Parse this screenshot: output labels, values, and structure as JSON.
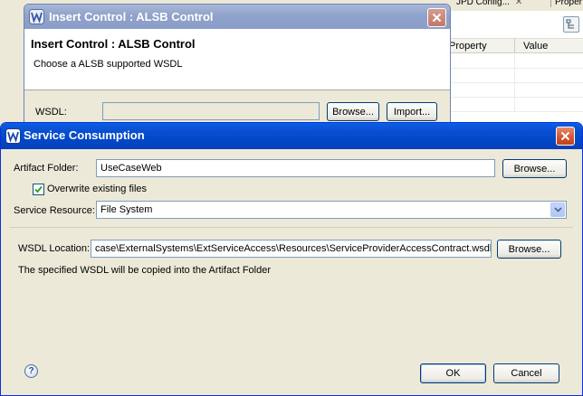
{
  "background": {
    "tabs": [
      {
        "label": "JPD Config...",
        "close": "✕"
      },
      {
        "label": "Proper"
      }
    ],
    "properties_header": {
      "property": "Property",
      "value": "Value"
    }
  },
  "insert_dialog": {
    "title": "Insert Control : ALSB Control",
    "heading": "Insert Control : ALSB Control",
    "subtitle": "Choose a ALSB supported WSDL",
    "wsdl_label": "WSDL:",
    "wsdl_value": "",
    "browse_label": "Browse...",
    "import_label": "Import..."
  },
  "service_dialog": {
    "title": "Service Consumption",
    "artifact_folder": {
      "label": "Artifact Folder:",
      "value": "UseCaseWeb",
      "browse_label": "Browse..."
    },
    "overwrite": {
      "label": "Overwrite existing files",
      "checked": true
    },
    "service_resource": {
      "label": "Service Resource:",
      "selected": "File System"
    },
    "wsdl_location": {
      "label": "WSDL Location:",
      "value": "case\\ExternalSystems\\ExtServiceAccess\\Resources\\ServiceProviderAccessContract.wsdl",
      "browse_label": "Browse...",
      "note": "The specified WSDL will be copied into the Artifact Folder"
    },
    "ok_label": "OK",
    "cancel_label": "Cancel"
  },
  "icons": {
    "app_logo": "weblogic-logo-icon",
    "close": "close-icon",
    "help": "help-icon",
    "dropdown": "chevron-down-icon",
    "check": "checkmark-icon",
    "toolbar": "view-toolbar-icon"
  },
  "colors": {
    "title_active": "#0a4fd0",
    "title_inactive": "#8fa2ca",
    "close_active": "#d2532d",
    "dialog_bg": "#ece9d8",
    "input_border": "#7f9db9"
  }
}
